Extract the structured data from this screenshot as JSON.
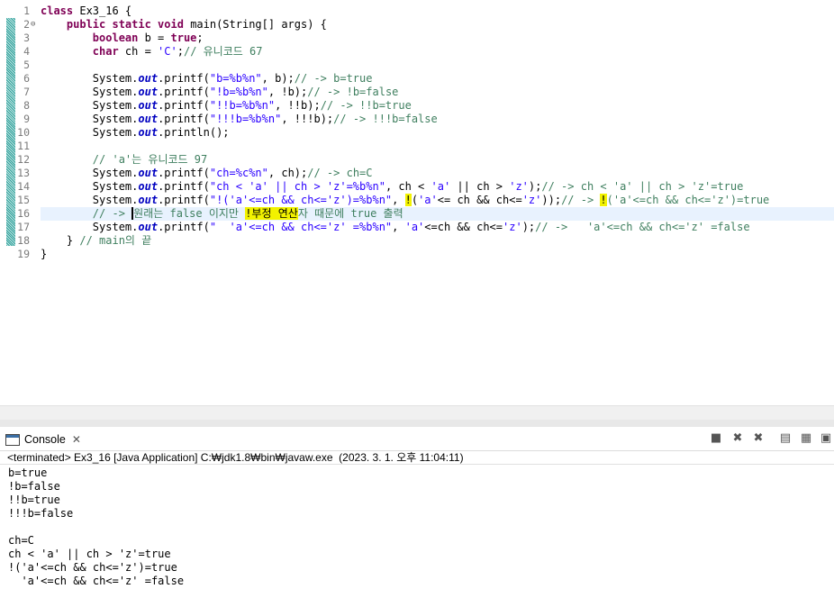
{
  "editor": {
    "line_numbers": [
      "1",
      "2",
      "3",
      "4",
      "5",
      "6",
      "7",
      "8",
      "9",
      "10",
      "11",
      "12",
      "13",
      "14",
      "15",
      "16",
      "17",
      "18",
      "19"
    ],
    "fold_marker": "⊖",
    "lines": [
      [
        {
          "t": "class ",
          "c": "kw"
        },
        {
          "t": "Ex3_16 {",
          "c": ""
        }
      ],
      [
        {
          "t": "    ",
          "c": ""
        },
        {
          "t": "public static void ",
          "c": "kw"
        },
        {
          "t": "main(String[] args) {",
          "c": ""
        }
      ],
      [
        {
          "t": "        ",
          "c": ""
        },
        {
          "t": "boolean ",
          "c": "kw"
        },
        {
          "t": "b = ",
          "c": ""
        },
        {
          "t": "true",
          "c": "kw"
        },
        {
          "t": ";",
          "c": ""
        }
      ],
      [
        {
          "t": "        ",
          "c": ""
        },
        {
          "t": "char ",
          "c": "kw"
        },
        {
          "t": "ch = ",
          "c": ""
        },
        {
          "t": "'C'",
          "c": "str"
        },
        {
          "t": ";",
          "c": ""
        },
        {
          "t": "// 유니코드 67",
          "c": "cmt"
        }
      ],
      [],
      [
        {
          "t": "        System.",
          "c": ""
        },
        {
          "t": "out",
          "c": "fld"
        },
        {
          "t": ".printf(",
          "c": ""
        },
        {
          "t": "\"b=%b%n\"",
          "c": "str"
        },
        {
          "t": ", b);",
          "c": ""
        },
        {
          "t": "// -> b=true",
          "c": "cmt"
        }
      ],
      [
        {
          "t": "        System.",
          "c": ""
        },
        {
          "t": "out",
          "c": "fld"
        },
        {
          "t": ".printf(",
          "c": ""
        },
        {
          "t": "\"!b=%b%n\"",
          "c": "str"
        },
        {
          "t": ", !b);",
          "c": ""
        },
        {
          "t": "// -> !b=false",
          "c": "cmt"
        }
      ],
      [
        {
          "t": "        System.",
          "c": ""
        },
        {
          "t": "out",
          "c": "fld"
        },
        {
          "t": ".printf(",
          "c": ""
        },
        {
          "t": "\"!!b=%b%n\"",
          "c": "str"
        },
        {
          "t": ", !!b);",
          "c": ""
        },
        {
          "t": "// -> !!b=true",
          "c": "cmt"
        }
      ],
      [
        {
          "t": "        System.",
          "c": ""
        },
        {
          "t": "out",
          "c": "fld"
        },
        {
          "t": ".printf(",
          "c": ""
        },
        {
          "t": "\"!!!b=%b%n\"",
          "c": "str"
        },
        {
          "t": ", !!!b);",
          "c": ""
        },
        {
          "t": "// -> !!!b=false",
          "c": "cmt"
        }
      ],
      [
        {
          "t": "        System.",
          "c": ""
        },
        {
          "t": "out",
          "c": "fld"
        },
        {
          "t": ".println();",
          "c": ""
        }
      ],
      [],
      [
        {
          "t": "        ",
          "c": ""
        },
        {
          "t": "// 'a'는 유니코드 97",
          "c": "cmt"
        }
      ],
      [
        {
          "t": "        System.",
          "c": ""
        },
        {
          "t": "out",
          "c": "fld"
        },
        {
          "t": ".printf(",
          "c": ""
        },
        {
          "t": "\"ch=%c%n\"",
          "c": "str"
        },
        {
          "t": ", ch);",
          "c": ""
        },
        {
          "t": "// -> ch=C",
          "c": "cmt"
        }
      ],
      [
        {
          "t": "        System.",
          "c": ""
        },
        {
          "t": "out",
          "c": "fld"
        },
        {
          "t": ".printf(",
          "c": ""
        },
        {
          "t": "\"ch < 'a' || ch > 'z'=%b%n\"",
          "c": "str"
        },
        {
          "t": ", ch < ",
          "c": ""
        },
        {
          "t": "'a'",
          "c": "str"
        },
        {
          "t": " || ch > ",
          "c": ""
        },
        {
          "t": "'z'",
          "c": "str"
        },
        {
          "t": ");",
          "c": ""
        },
        {
          "t": "// -> ch < 'a' || ch > 'z'=true",
          "c": "cmt"
        }
      ],
      [
        {
          "t": "        System.",
          "c": ""
        },
        {
          "t": "out",
          "c": "fld"
        },
        {
          "t": ".printf(",
          "c": ""
        },
        {
          "t": "\"!('a'<=ch && ch<='z')=%b%n\"",
          "c": "str"
        },
        {
          "t": ", ",
          "c": ""
        },
        {
          "t": "!",
          "c": "hl"
        },
        {
          "t": "(",
          "c": ""
        },
        {
          "t": "'a'",
          "c": "str"
        },
        {
          "t": "<= ch && ch<=",
          "c": ""
        },
        {
          "t": "'z'",
          "c": "str"
        },
        {
          "t": "));",
          "c": ""
        },
        {
          "t": "// -> ",
          "c": "cmt"
        },
        {
          "t": "!",
          "c": "hl"
        },
        {
          "t": "('a'<=ch && ch<='z')=true",
          "c": "cmt"
        }
      ],
      [
        {
          "t": "        // -> ",
          "c": "cmt"
        },
        {
          "t": "",
          "c": "caret"
        },
        {
          "t": "원래는 false 이지만 ",
          "c": "cmt"
        },
        {
          "t": "!부정 연산",
          "c": "hl"
        },
        {
          "t": "자 때문에 true 출력",
          "c": "cmt"
        }
      ],
      [
        {
          "t": "        System.",
          "c": ""
        },
        {
          "t": "out",
          "c": "fld"
        },
        {
          "t": ".printf(",
          "c": ""
        },
        {
          "t": "\"  'a'<=ch && ch<='z' =%b%n\"",
          "c": "str"
        },
        {
          "t": ", ",
          "c": ""
        },
        {
          "t": "'a'",
          "c": "str"
        },
        {
          "t": "<=ch && ch<=",
          "c": ""
        },
        {
          "t": "'z'",
          "c": "str"
        },
        {
          "t": ");",
          "c": ""
        },
        {
          "t": "// ->   'a'<=ch && ch<='z' =false",
          "c": "cmt"
        }
      ],
      [
        {
          "t": "    } ",
          "c": ""
        },
        {
          "t": "// main의 끝",
          "c": "cmt"
        }
      ],
      [
        {
          "t": "}",
          "c": ""
        }
      ]
    ]
  },
  "console": {
    "tab_label": "Console",
    "tab_icon": "console-view-icon",
    "close_icon": "✕",
    "toolbar_icons": [
      "terminate-icon",
      "remove-launch-icon",
      "remove-all-terminated-icon",
      "scroll-lock-icon",
      "show-console-icon",
      "pin-console-icon"
    ],
    "status": "<terminated> Ex3_16 [Java Application] C:₩jdk1.8₩bin₩javaw.exe  (2023. 3. 1. 오후 11:04:11)",
    "output": [
      "b=true",
      "!b=false",
      "!!b=true",
      "!!!b=false",
      "",
      "ch=C",
      "ch < 'a' || ch > 'z'=true",
      "!('a'<=ch && ch<='z')=true",
      "  'a'<=ch && ch<='z' =false"
    ]
  }
}
